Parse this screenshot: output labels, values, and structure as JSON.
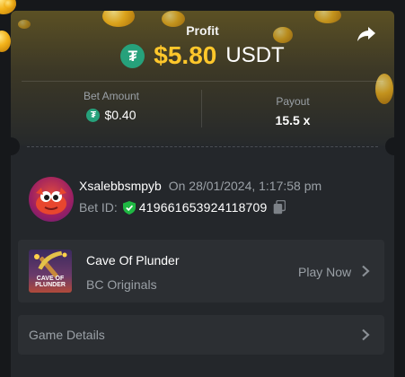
{
  "colors": {
    "accent_gold": "#ffc72b",
    "tether_green": "#26a17b",
    "card_bg": "#24272b",
    "row_bg": "#2c2f33",
    "muted_text": "#9aa0a6"
  },
  "header": {
    "title": "Profit",
    "amount": "$5.80",
    "currency": "USDT",
    "currency_icon": "tether-icon",
    "share_icon": "share-icon"
  },
  "stats": {
    "bet_amount_label": "Bet Amount",
    "bet_amount_value": "$0.40",
    "payout_label": "Payout",
    "payout_value": "15.5 x"
  },
  "bet": {
    "username": "Xsalebbsmpyb",
    "date": "On 28/01/2024, 1:17:58 pm",
    "bet_id_label": "Bet ID:",
    "bet_id": "419661653924118709",
    "verified_icon": "shield-check-icon",
    "copy_icon": "copy-icon"
  },
  "game": {
    "name": "Cave Of Plunder",
    "provider": "BC Originals",
    "thumb_text_1": "CAVE OF",
    "thumb_text_2": "PLUNDER",
    "action": "Play Now"
  },
  "details": {
    "label": "Game Details"
  }
}
